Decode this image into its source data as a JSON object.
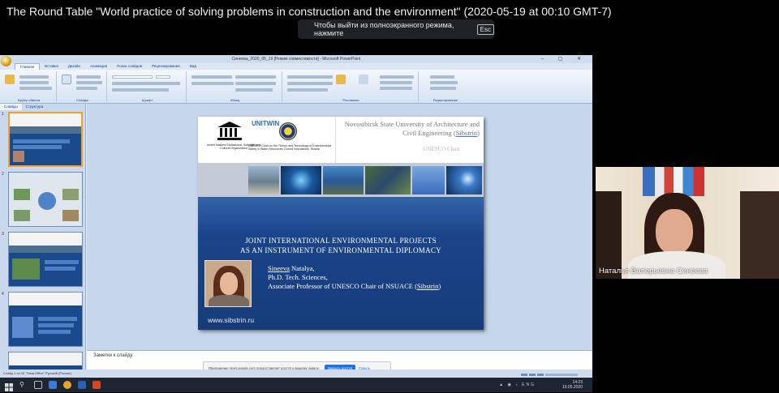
{
  "meeting": {
    "title": "The Round Table \"World practice of solving problems in construction and the environment\" (2020-05-19 at 00:10 GMT-7)",
    "fullscreen_hint": "Чтобы выйти из полноэкранного режима, нажмите",
    "fullscreen_key": "Esc"
  },
  "powerpoint": {
    "window_title": "Синеева_2020_05_19 [Режим совместимости] - Microsoft PowerPoint",
    "ribbon_tabs": [
      "Главная",
      "Вставка",
      "Дизайн",
      "Анимация",
      "Показ слайдов",
      "Рецензирование",
      "Вид"
    ],
    "ribbon_groups": [
      "Буфер обмена",
      "Слайды",
      "Шрифт",
      "Абзац",
      "Рисование",
      "Редактирование"
    ],
    "pane_tabs": [
      "Слайды",
      "Структура"
    ],
    "slide_numbers": [
      "1",
      "2",
      "3",
      "4"
    ],
    "notes_placeholder": "Заметки к слайду",
    "status": "Слайд 1 из 33   \"Тема Office\"   Русский (Россия)"
  },
  "slide": {
    "unesco_org": "United Nations Educational, Scientific and Cultural Organization",
    "unitwin": "UNITWIN",
    "chair_text": "UNESCO Chair on the Theory and Technology of Environmental Safety in Water Resources Control Novosibirsk, Russia",
    "university": "Novosibirsk State University of Architecture and Civil Engineering (",
    "university_abbr": "Sibstrin",
    "university_close": ")",
    "unesco_chair": "UNESCO Chair",
    "title_line1": "JOINT INTERNATIONAL ENVIRONMENTAL PROJECTS",
    "title_line2": "AS AN INSTRUMENT OF ENVIRONMENTAL DIPLOMACY",
    "author_surname": "Sineeva",
    "author_name": " Natalya,",
    "author_degree": "Ph.D. Tech. Sciences,",
    "author_position": "Associate Professor of UNESCO Chair of NSUACE (",
    "author_abbr": "Sibstrin",
    "author_close": ")",
    "website": "www.sibstrin.ru"
  },
  "share_popup": {
    "text": "Приложение meet.google.com предоставляет доступ к вашему экрану.",
    "stop_button": "Закрыть доступ",
    "hide_button": "Скрыть"
  },
  "taskbar": {
    "lang": "ENG",
    "time": "14:23",
    "date": "19.05.2020"
  },
  "participant": {
    "name": "Наталья Валерьевна Синеева"
  }
}
